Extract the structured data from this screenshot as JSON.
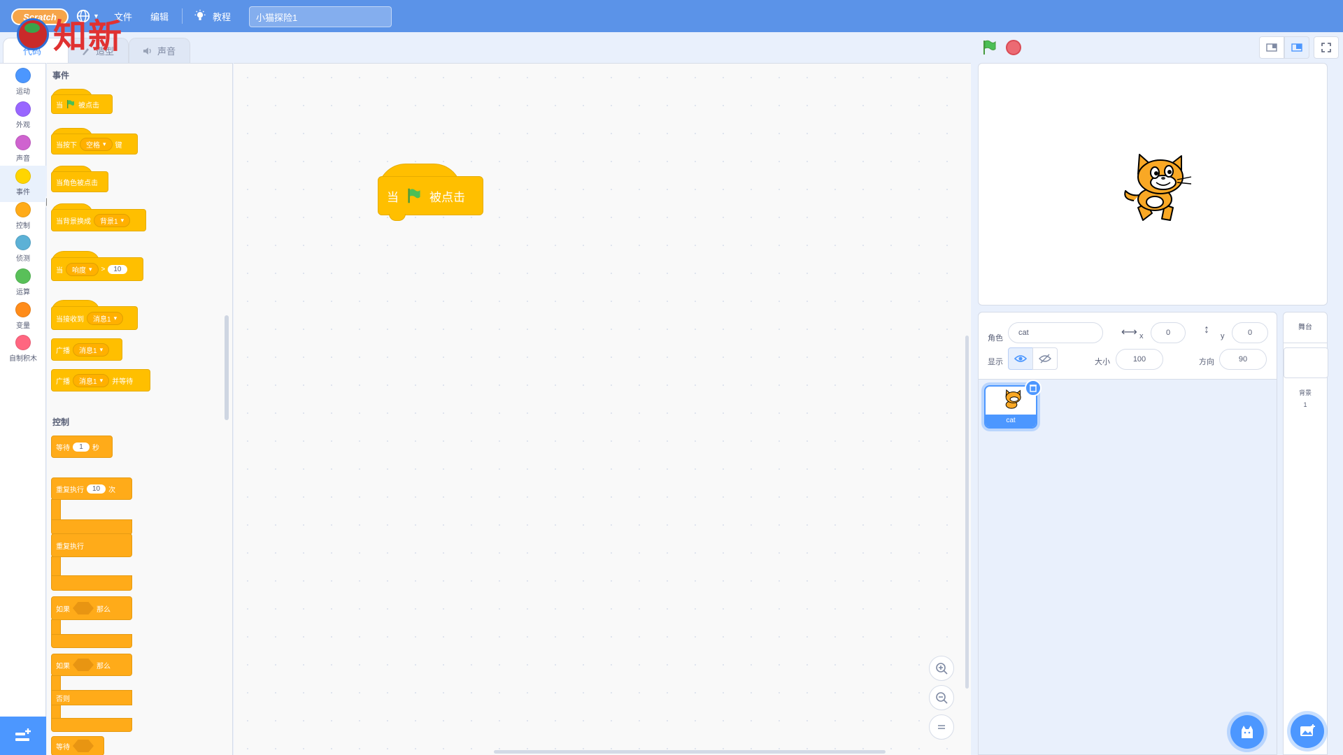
{
  "app": {
    "logo_text": "知新",
    "logo_word": "Scratch",
    "project_title": "小猫探险1"
  },
  "menu": {
    "file": "文件",
    "edit": "编辑",
    "tutorial": "教程"
  },
  "tabs": {
    "code": "代码",
    "costume": "造型",
    "sound": "声音"
  },
  "categories": [
    {
      "label": "运动",
      "color": "#4c97ff"
    },
    {
      "label": "外观",
      "color": "#9966ff"
    },
    {
      "label": "声音",
      "color": "#cf63cf"
    },
    {
      "label": "事件",
      "color": "#ffd500"
    },
    {
      "label": "控制",
      "color": "#ffab19"
    },
    {
      "label": "侦测",
      "color": "#5cb1d6"
    },
    {
      "label": "运算",
      "color": "#59c059"
    },
    {
      "label": "变量",
      "color": "#ff8c1a"
    },
    {
      "label": "自制积木",
      "color": "#ff6680"
    }
  ],
  "palette": {
    "events_heading": "事件",
    "control_heading": "控制",
    "events": {
      "flag_clicked": {
        "pre": "当",
        "post": "被点击"
      },
      "key_pressed": {
        "pre": "当按下",
        "key": "空格",
        "post": "键"
      },
      "sprite_clicked": "当角色被点击",
      "backdrop_switch": {
        "pre": "当背景换成",
        "value": "背景1"
      },
      "greater_than": {
        "pre": "当",
        "value": "响度",
        "op": ">",
        "num": "10"
      },
      "receive": {
        "pre": "当接收到",
        "value": "消息1"
      },
      "broadcast": {
        "pre": "广播",
        "value": "消息1"
      },
      "broadcast_wait": {
        "pre": "广播",
        "value": "消息1",
        "post": "并等待"
      }
    },
    "control": {
      "wait": {
        "pre": "等待",
        "num": "1",
        "post": "秒"
      },
      "repeat": {
        "pre": "重复执行",
        "num": "10",
        "post": "次"
      },
      "forever": "重复执行",
      "if_then": {
        "pre": "如果",
        "post": "那么"
      },
      "if_else": {
        "pre": "如果",
        "post": "那么",
        "else": "否则"
      },
      "wait_until": "等待"
    }
  },
  "script": {
    "pre": "当",
    "post": "被点击"
  },
  "sprite_info": {
    "sprite_label": "角色",
    "sprite_name": "cat",
    "x_label": "x",
    "x": "0",
    "y_label": "y",
    "y": "0",
    "show_label": "显示",
    "size_label": "大小",
    "size": "100",
    "direction_label": "方向",
    "direction": "90"
  },
  "sprites": [
    {
      "name": "cat"
    }
  ],
  "stage_pane": {
    "title": "舞台",
    "backdrop_label": "背景",
    "backdrop_count": "1"
  },
  "colors": {
    "menubar": "#5b93e8",
    "accent": "#4c97ff",
    "events": "#ffbf00",
    "control": "#ffab19"
  }
}
